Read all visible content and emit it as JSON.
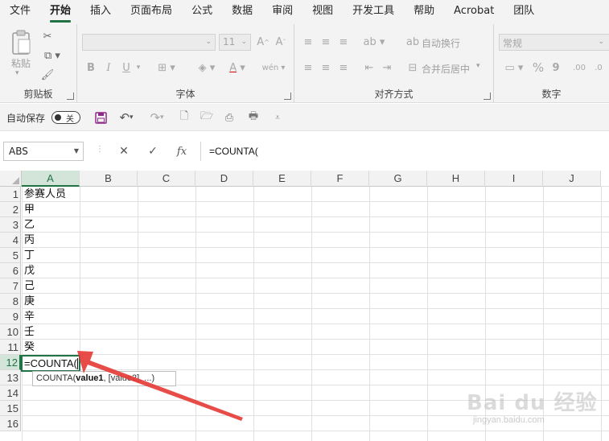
{
  "menu": {
    "items": [
      "文件",
      "开始",
      "插入",
      "页面布局",
      "公式",
      "数据",
      "审阅",
      "视图",
      "开发工具",
      "帮助",
      "Acrobat",
      "团队"
    ],
    "active_index": 1
  },
  "ribbon": {
    "clipboard": {
      "paste_label": "粘贴",
      "group_label": "剪贴板"
    },
    "font": {
      "font_size": "11",
      "bold": "B",
      "italic": "I",
      "underline": "U",
      "group_label": "字体"
    },
    "alignment": {
      "wrap_text": "自动换行",
      "merge_center": "合并后居中",
      "group_label": "对齐方式"
    },
    "number": {
      "format": "常规",
      "group_label": "数字"
    }
  },
  "qat": {
    "autosave_label": "自动保存",
    "toggle_label": "关"
  },
  "formula_bar": {
    "name_box": "ABS",
    "fx": "fx",
    "formula": "=COUNTA("
  },
  "grid": {
    "columns": [
      "A",
      "B",
      "C",
      "D",
      "E",
      "F",
      "G",
      "H",
      "I",
      "J"
    ],
    "rows": [
      "1",
      "2",
      "3",
      "4",
      "5",
      "6",
      "7",
      "8",
      "9",
      "10",
      "11",
      "12",
      "13",
      "14",
      "15",
      "16"
    ],
    "cells_a": [
      "参赛人员",
      "甲",
      "乙",
      "丙",
      "丁",
      "戊",
      "己",
      "庚",
      "辛",
      "壬",
      "癸"
    ],
    "active_cell_value": "=COUNTA(",
    "tooltip": {
      "func": "COUNTA(",
      "arg1": "value1",
      "rest": ", [value2], ...)"
    }
  },
  "watermark": {
    "main": "Bai du 经验",
    "sub": "jingyan.baidu.com"
  },
  "colors": {
    "accent": "#217346",
    "arrow": "#e53935"
  }
}
